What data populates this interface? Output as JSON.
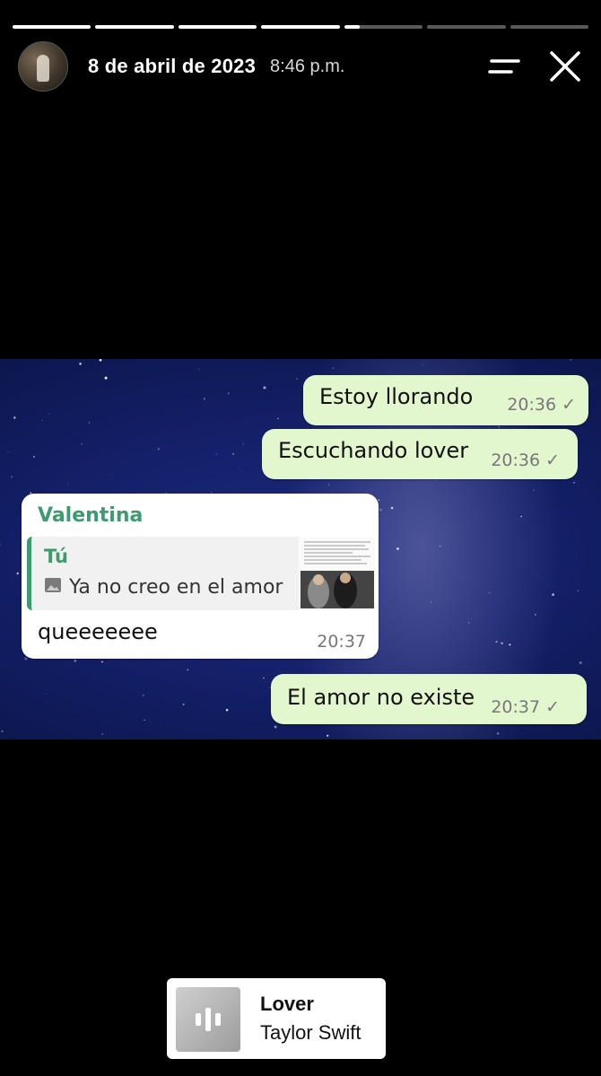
{
  "story": {
    "segments": [
      {
        "progress": 1
      },
      {
        "progress": 1
      },
      {
        "progress": 1
      },
      {
        "progress": 1
      },
      {
        "progress": 0.2
      },
      {
        "progress": 0
      },
      {
        "progress": 0
      }
    ],
    "date": "8 de abril de 2023",
    "time": "8:46 p.m."
  },
  "chat": {
    "messages": [
      {
        "text": "Estoy llorando",
        "time": "20:36"
      },
      {
        "text": "Escuchando lover",
        "time": "20:36"
      },
      {
        "sender": "Valentina",
        "quote_author": "Tú",
        "quote_text": "Ya no creo en el amor",
        "text": "queeeeeee",
        "time": "20:37"
      },
      {
        "text": "El amor no existe",
        "time": "20:37"
      }
    ]
  },
  "music": {
    "song": "Lover",
    "artist": "Taylor Swift"
  },
  "colors": {
    "outgoing_bubble": "#e3f7cf",
    "sender_name": "#3d9b70"
  }
}
